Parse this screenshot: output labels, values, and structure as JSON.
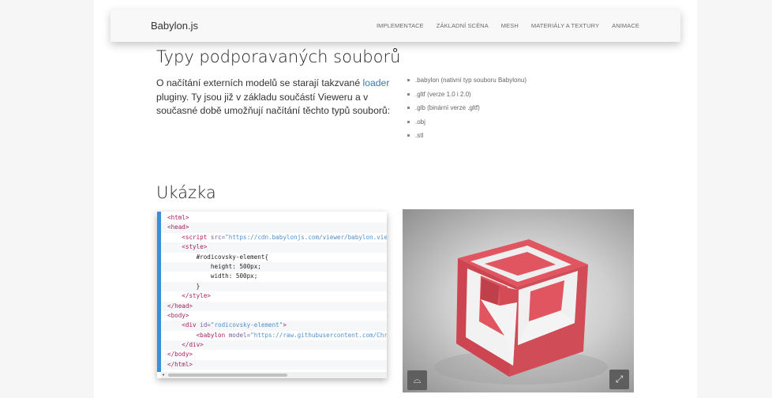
{
  "navbar": {
    "brand": "Babylon.js",
    "links": [
      "IMPLEMENTACE",
      "ZÁKLADNÍ SCÉNA",
      "MESH",
      "MATERIÁLY A TEXTURY",
      "ANIMACE"
    ]
  },
  "types_section": {
    "heading": "Typy podporavaných souborů",
    "intro_before_link": "O načítání externích modelů se starají takzvané ",
    "intro_link": "loader",
    "intro_after_link": " pluginy. Ty jsou již v základu součástí Vieweru a v současné době umožňují načítání těchto typů souborů:",
    "formats": [
      ".babylon (nativní typ souboru Babylonu)",
      ".gltf (verze 1.0 i 2.0)",
      ".glb (binární verze .gltf)",
      ".obj",
      ".stl"
    ]
  },
  "sample_section": {
    "heading": "Ukázka",
    "code": {
      "l1": "<html>",
      "l2": "<head>",
      "l3_tag_open": "<script",
      "l3_attr": " src=",
      "l3_value": "\"https://cdn.babylonjs.com/viewer/babylon.viewer.js\"",
      "l4": "<style>",
      "l5": "#rodicovsky-element{",
      "l6": "height: 500px;",
      "l7": "width: 500px;",
      "l8": "}",
      "l9": "</style>",
      "l10": "</head>",
      "l11": "<body>",
      "l12_tag_open": "<div",
      "l12_attr": " id=",
      "l12_value": "\"rodicovsky-element\"",
      "l12_close": ">",
      "l13_tag_open": "<babylon",
      "l13_attr": " model=",
      "l13_value": "\"https://raw.githubusercontent.com/Chr",
      "l14": "</div>",
      "l15": "</body>",
      "l16": "</html>",
      "scroll_left_arrow": "◂"
    },
    "viewer": {
      "vr_icon": "vr-goggles-icon",
      "vr_glyph": "⌓",
      "fullscreen_icon": "fullscreen-icon",
      "fullscreen_glyph": "⤢",
      "colors": {
        "cube_red": "#d8505a",
        "cube_white": "#f2f2f2"
      }
    }
  }
}
